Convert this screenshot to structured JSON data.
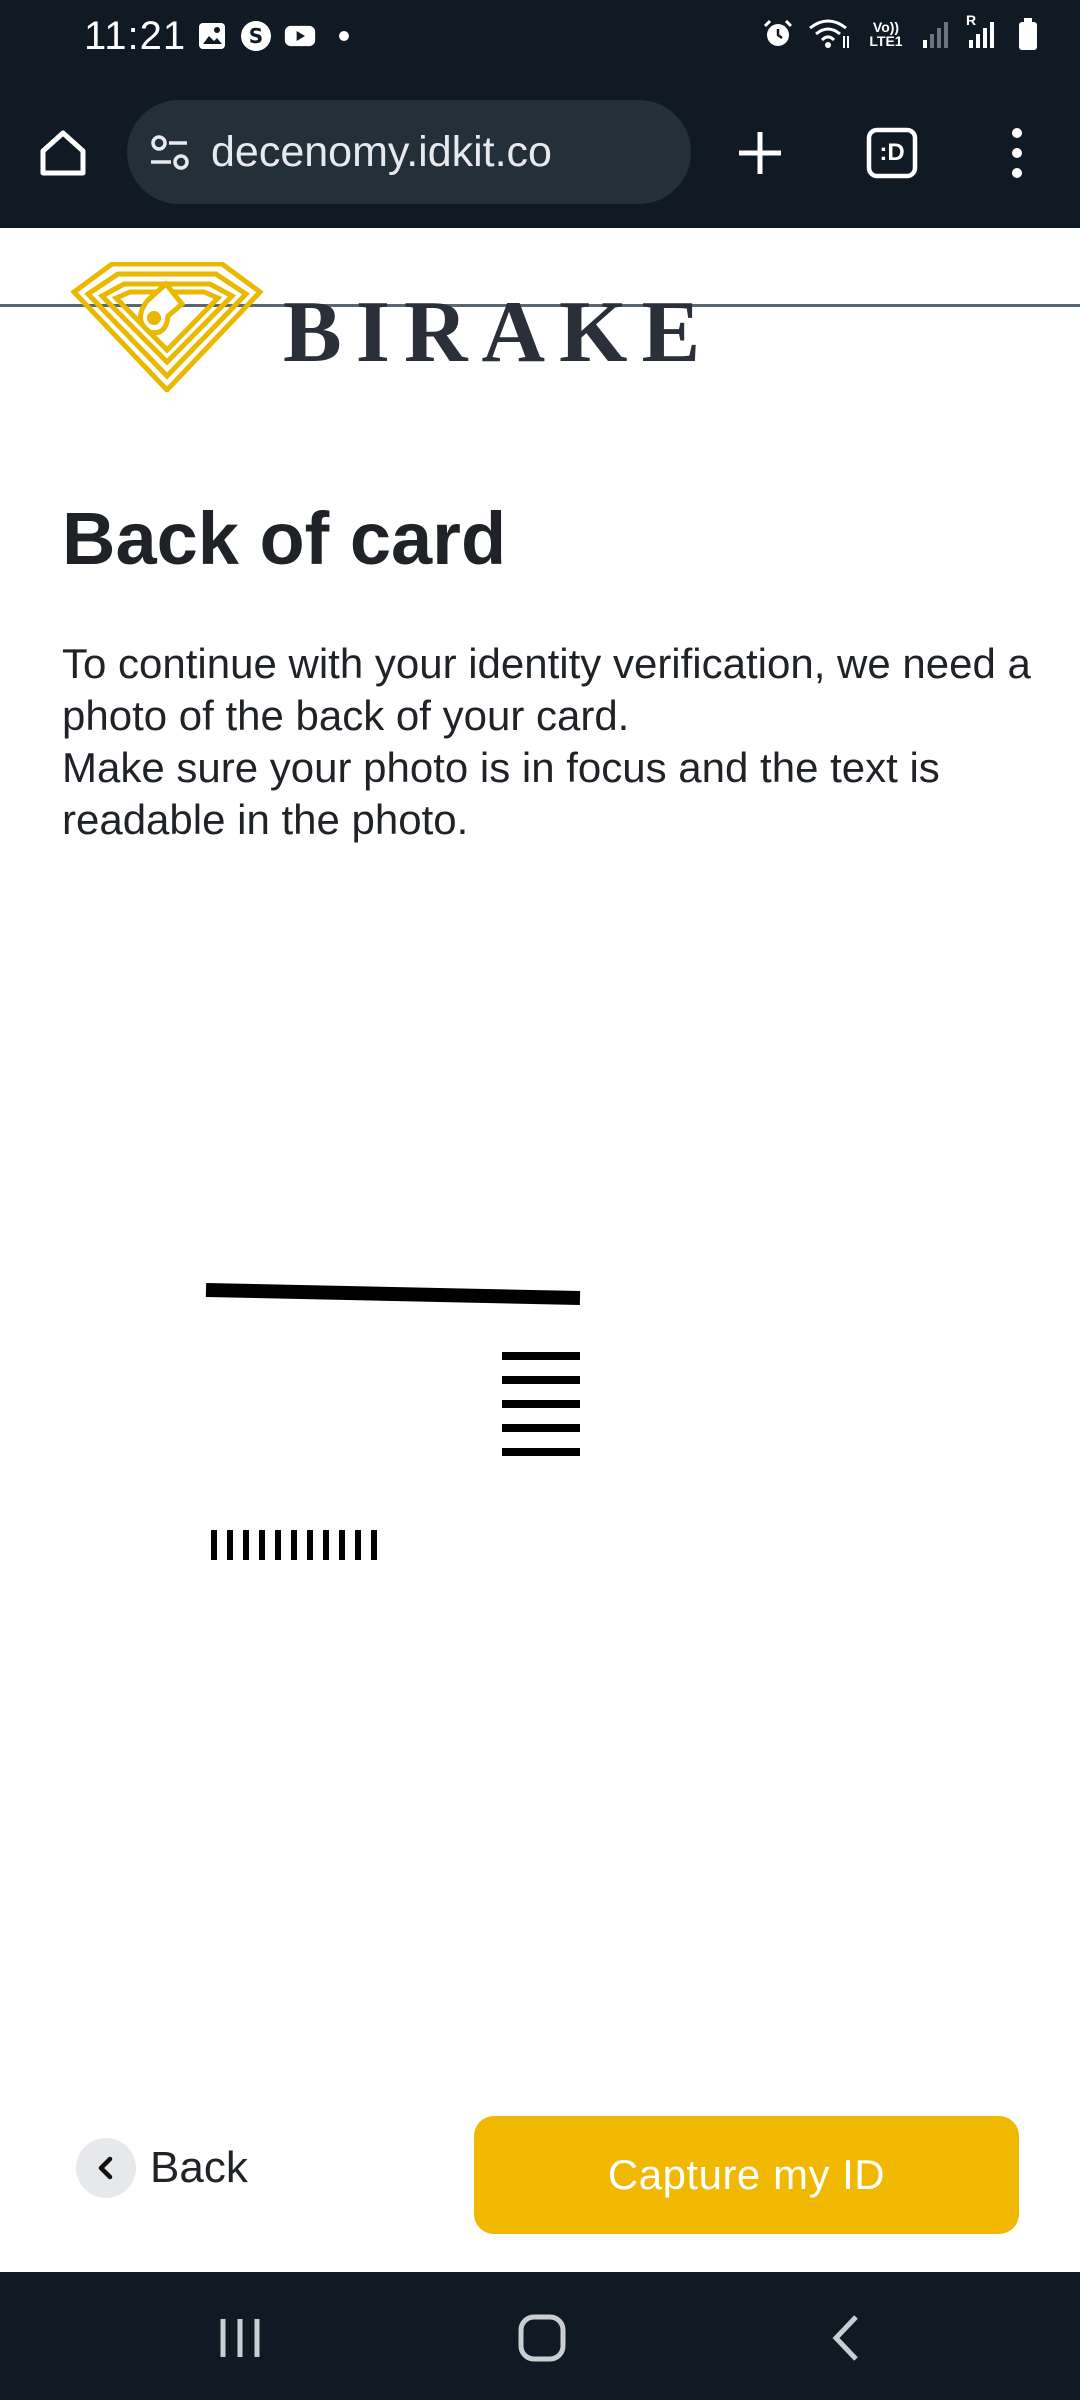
{
  "status_bar": {
    "time": "11:21",
    "left_icons": [
      "gallery-icon",
      "s-app-icon",
      "youtube-icon",
      "notification-dot-icon"
    ],
    "right_icons": [
      "alarm-icon",
      "wifi-icon",
      "volte-icon",
      "signal-icon",
      "signal-roaming-icon",
      "battery-icon"
    ],
    "volte_label": "Vo)) LTE1",
    "roaming_label": "R"
  },
  "browser": {
    "url": "decenomy.idkit.co",
    "tab_label": ":D",
    "icons": [
      "home-icon",
      "site-settings-icon",
      "new-tab-plus-icon",
      "tab-switcher-icon",
      "more-menu-icon"
    ]
  },
  "brand": {
    "name": "BIRAKE",
    "logo_color": "#e9b800"
  },
  "page": {
    "title": "Back of card",
    "description_line1": "To continue with your identity verification, we need a photo of the back of your card.",
    "description_line2": "Make sure your photo is in focus and the text is readable in the photo."
  },
  "actions": {
    "back_label": "Back",
    "capture_label": "Capture my ID",
    "capture_color": "#f0b800"
  },
  "nav_bar": {
    "icons": [
      "recent-apps-icon",
      "home-nav-icon",
      "back-nav-icon"
    ]
  }
}
